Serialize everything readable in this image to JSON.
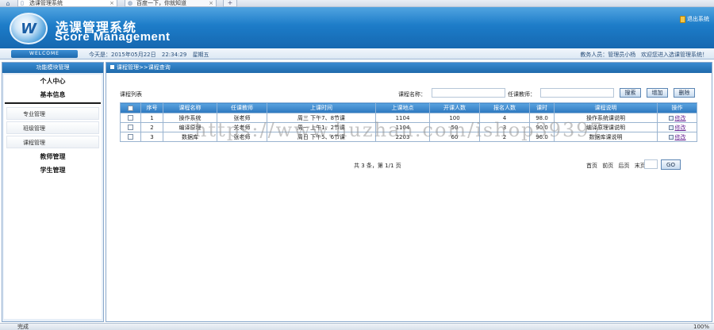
{
  "browser": {
    "tabs": [
      {
        "label": "选课管理系统"
      },
      {
        "label": "百度一下，你就知道"
      }
    ],
    "status_text": "完成",
    "zoom": "100%"
  },
  "header": {
    "logo_letter": "W",
    "title_cn": "选课管理系统",
    "title_en": "Score Management",
    "logout_label": "退出系统"
  },
  "statusbar": {
    "welcome": "WELCOME",
    "today_label": "今天是：2015年05月22日",
    "time": "22:34:29",
    "weekday": "星期五",
    "user_role": "教务人员：管理员小杨",
    "greeting": "欢迎您进入选课管理系统！"
  },
  "sidebar": {
    "header": "功能模块管理",
    "items": {
      "personal": "个人中心",
      "basic": "基本信息",
      "major": "专业管理",
      "class": "班级管理",
      "course": "课程管理",
      "teacher": "教师管理",
      "student": "学生管理"
    }
  },
  "main": {
    "breadcrumb": "课程管理>>课程查询",
    "list_title": "课程列表",
    "search": {
      "name_label": "课程名称：",
      "name_value": "",
      "teacher_label": "任课教师：",
      "teacher_value": ""
    },
    "buttons": {
      "search": "搜索",
      "add": "增加",
      "delete": "删除",
      "go": "GO"
    },
    "columns": [
      "序号",
      "课程名称",
      "任课教师",
      "上课时间",
      "上课地点",
      "开课人数",
      "报名人数",
      "课时",
      "课程说明",
      "操作"
    ],
    "rows": [
      {
        "no": "1",
        "name": "操作系统",
        "teacher": "张老师",
        "time": "周三 下午7、8节课",
        "place": "1104",
        "capacity": "100",
        "enrolled": "4",
        "hours": "98.0",
        "desc": "操作系统课说明",
        "op": "修改"
      },
      {
        "no": "2",
        "name": "编译原理",
        "teacher": "关老师",
        "time": "周一 上午1、2节课",
        "place": "1104",
        "capacity": "50",
        "enrolled": "3",
        "hours": "90.0",
        "desc": "编译原理课说明",
        "op": "修改"
      },
      {
        "no": "3",
        "name": "数据库",
        "teacher": "张老师",
        "time": "周日 下午5、6节课",
        "place": "2203",
        "capacity": "60",
        "enrolled": "2",
        "hours": "96.0",
        "desc": "数据库课说明",
        "op": "修改"
      }
    ],
    "pager": {
      "info": "共 3 条，第 1/1 页",
      "first": "首页",
      "prev": "前页",
      "next": "后页",
      "last": "末页",
      "page_value": ""
    }
  },
  "watermark": "https://www.huzhan.com/ishop39397"
}
